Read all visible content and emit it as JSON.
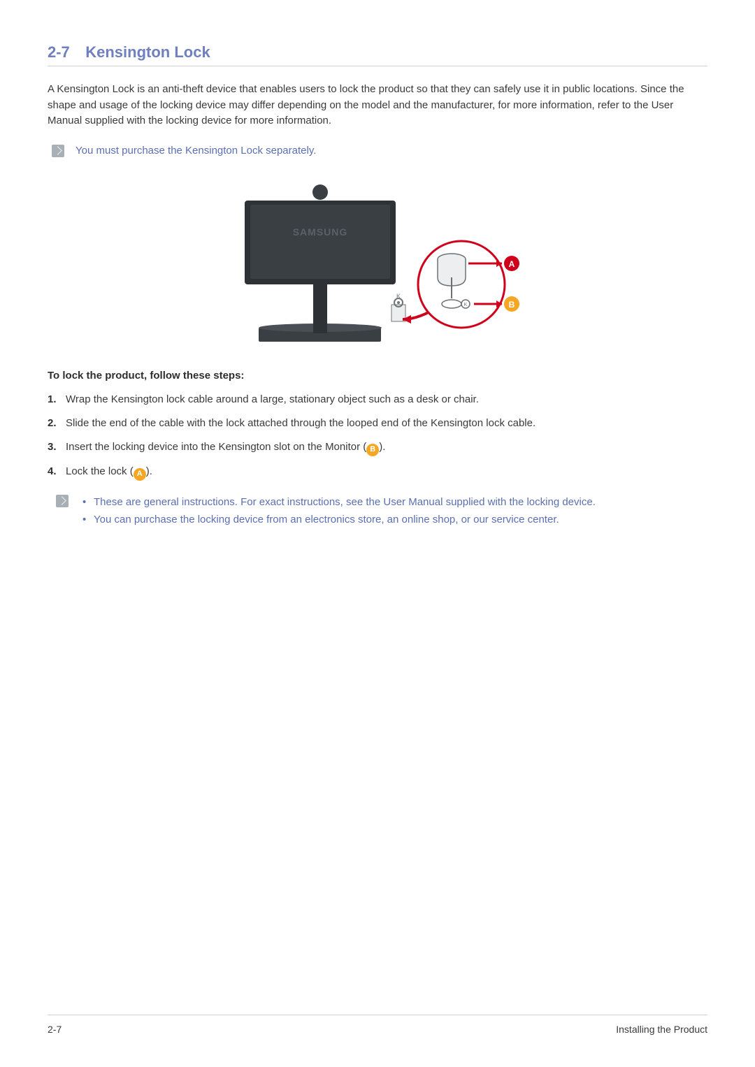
{
  "header": {
    "section_number": "2-7",
    "title": "Kensington Lock"
  },
  "intro_paragraph": "A Kensington Lock is an anti-theft device that enables users to lock the product so that they can safely use it in public locations. Since the shape and usage of the locking device may differ depending on the model and the manufacturer, for more information, refer to the User Manual supplied with the locking device for more information.",
  "note1": "You must purchase the Kensington Lock separately.",
  "diagram": {
    "brand_label": "SAMSUNG",
    "marker_a": "A",
    "marker_b": "B"
  },
  "steps_title": "To lock the product, follow these steps:",
  "steps": {
    "s1": "Wrap the Kensington lock cable around a large, stationary object such as a desk or chair.",
    "s2": "Slide the end of the cable with the lock attached through the looped end of the Kensington lock cable.",
    "s3_pre": " Insert the locking device into the Kensington slot on the Monitor (",
    "s3_badge": "B",
    "s3_post": ").",
    "s4_pre": "Lock the lock (",
    "s4_badge": "A",
    "s4_post": ")."
  },
  "notes2": {
    "n1": "These are general instructions. For exact instructions, see the User Manual supplied with the locking device.",
    "n2": "You can purchase the locking device from an electronics store, an online shop, or our service center."
  },
  "footer": {
    "left": "2-7",
    "right": "Installing the Product"
  }
}
